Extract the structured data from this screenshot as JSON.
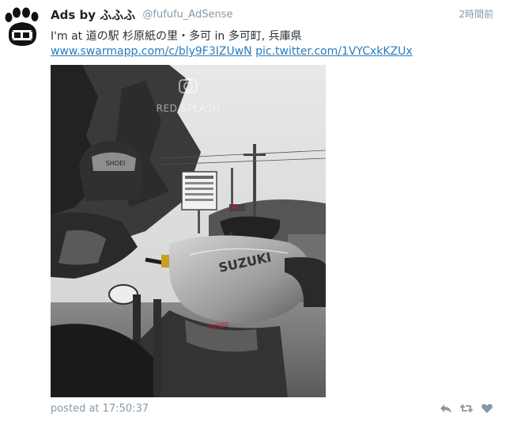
{
  "tweet": {
    "author_name": "Ads by ふふふ",
    "author_handle": "@fufufu_AdSense",
    "relative_time": "2時間前",
    "text": "I'm at 道の駅 杉原紙の里・多可 in 多可町, 兵庫県",
    "link_checkin": "www.swarmapp.com/c/bly9F3IZUwN",
    "link_photo": "pic.twitter.com/1VYCxkKZUx",
    "posted_at": "posted at 17:50:37"
  },
  "photo": {
    "watermark_text": "RED SPLASH",
    "sign_text": "山 下",
    "helmet_text": "SHOEI",
    "tank_text": "SUZUKI",
    "model_text": "SV650"
  },
  "icons": {
    "avatar": "paw-print-film-logo",
    "reply": "reply-icon",
    "retweet": "retweet-icon",
    "like": "heart-icon",
    "watermark": "camera-icon"
  },
  "colors": {
    "link": "#2b7bb9",
    "muted": "#8899a6",
    "text": "#292f33",
    "accent_red": "#c8102e"
  }
}
